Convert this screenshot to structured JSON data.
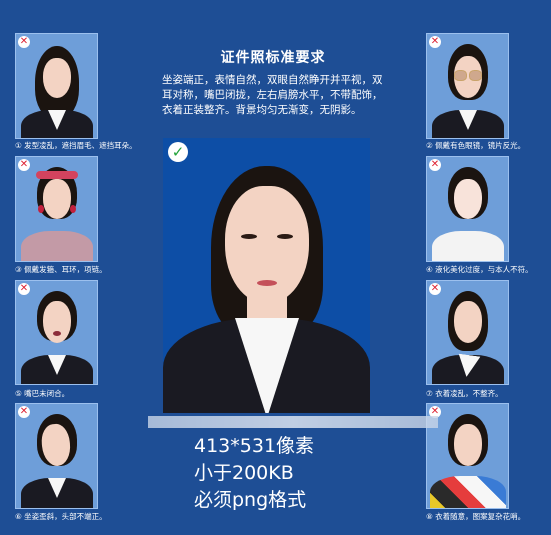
{
  "title": "证件照标准要求",
  "description": "坐姿端正，表情自然，双眼自然睁开并平视，双耳对称，嘴巴闭拢，左右肩膀水平，不带配饰，衣着正装整齐。背景均匀无渐变，无阴影。",
  "requirements": [
    "413*531像素",
    "小于200KB",
    "必须png格式"
  ],
  "left_examples": [
    {
      "caption": "① 发型凌乱，遮挡眉毛、遮挡耳朵。"
    },
    {
      "caption": "③ 佩戴发箍、耳环，项链。"
    },
    {
      "caption": "⑤ 嘴巴未闭合。"
    },
    {
      "caption": "⑥ 坐姿歪斜，头部不端正。"
    }
  ],
  "right_examples": [
    {
      "caption": "② 佩戴有色眼镜，镜片反光。"
    },
    {
      "caption": "④ 液化美化过度，与本人不符。"
    },
    {
      "caption": "⑦ 衣着凌乱，不整齐。"
    },
    {
      "caption": "⑧ 衣着随意，图案复杂花哨。"
    }
  ],
  "icons": {
    "reject": "x-icon",
    "approve": "check-icon"
  },
  "colors": {
    "background": "#1e4e95",
    "photo_bg": "#6e9ed9",
    "main_bg": "#0d4ea6"
  }
}
